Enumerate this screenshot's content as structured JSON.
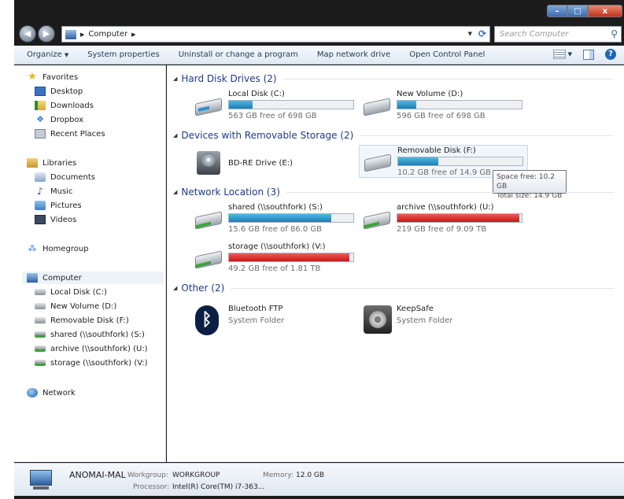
{
  "address": {
    "segments": [
      "Computer"
    ]
  },
  "search": {
    "placeholder": "Search Computer"
  },
  "toolbar": {
    "organize": "Organize",
    "system_properties": "System properties",
    "uninstall": "Uninstall or change a program",
    "map_drive": "Map network drive",
    "control_panel": "Open Control Panel"
  },
  "nav": {
    "favorites": "Favorites",
    "desktop": "Desktop",
    "downloads": "Downloads",
    "dropbox": "Dropbox",
    "recent": "Recent Places",
    "libraries": "Libraries",
    "documents": "Documents",
    "music": "Music",
    "pictures": "Pictures",
    "videos": "Videos",
    "homegroup": "Homegroup",
    "computer": "Computer",
    "local_disk": "Local Disk (C:)",
    "new_volume": "New Volume (D:)",
    "removable": "Removable Disk (F:)",
    "shared": "shared (\\\\southfork) (S:)",
    "archive": "archive (\\\\southfork) (U:)",
    "storage": "storage (\\\\southfork) (V:)",
    "network": "Network"
  },
  "groups": {
    "hdd": "Hard Disk Drives (2)",
    "removable": "Devices with Removable Storage (2)",
    "network": "Network Location (3)",
    "other": "Other (2)"
  },
  "drives": {
    "c": {
      "name": "Local Disk (C:)",
      "free": "563 GB free of 698 GB",
      "used_fraction": 0.19
    },
    "d": {
      "name": "New Volume (D:)",
      "free": "596 GB free of 698 GB",
      "used_fraction": 0.15
    },
    "e": {
      "name": "BD-RE Drive (E:)"
    },
    "f": {
      "name": "Removable Disk (F:)",
      "free": "10.2 GB free of 14.9 GB",
      "used_fraction": 0.32
    },
    "s": {
      "name": "shared (\\\\southfork) (S:)",
      "free": "15.6 GB free of 86.0 GB",
      "used_fraction": 0.82
    },
    "u": {
      "name": "archive (\\\\southfork) (U:)",
      "free": "219 GB free of 9.09 TB",
      "used_fraction": 0.98
    },
    "v": {
      "name": "storage (\\\\southfork) (V:)",
      "free": "49.2 GB free of 1.81 TB",
      "used_fraction": 0.97
    }
  },
  "other": {
    "bluetooth": {
      "name": "Bluetooth FTP",
      "type": "System Folder"
    },
    "keepsafe": {
      "name": "KeepSafe",
      "type": "System Folder"
    }
  },
  "tooltip": {
    "line1": "Space free: 10.2 GB",
    "line2": "Total size: 14.9 GB"
  },
  "details": {
    "hostname": "ANOMAI-MAL",
    "workgroup_label": "Workgroup:",
    "workgroup": "WORKGROUP",
    "memory_label": "Memory:",
    "memory": "12.0 GB",
    "processor_label": "Processor:",
    "processor": "Intel(R) Core(TM) i7-363..."
  },
  "colors": {
    "bar_normal": "#1f7fb3",
    "bar_full": "#c41818",
    "group_header": "#1e3a8a"
  }
}
